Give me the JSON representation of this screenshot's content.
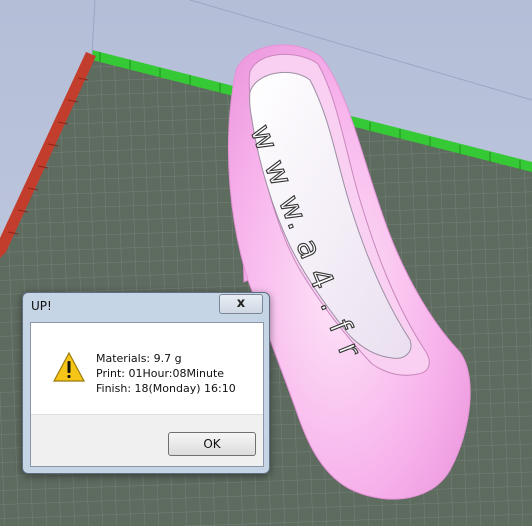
{
  "dialog": {
    "title": "UP!",
    "close_label": "x",
    "icon": "warning-icon",
    "lines": [
      "Materials: 9.7 g",
      "Print: 01Hour:08Minute",
      "Finish: 18(Monday) 16:10"
    ],
    "ok_label": "OK"
  },
  "model": {
    "insole_text": "w w w. a 4 . f r",
    "color": "#f2a6e6"
  },
  "colors": {
    "background": "#b9c3db",
    "grid_floor": "#5e6b5f",
    "grid_ruler_green": "#2fd12f",
    "grid_ruler_red": "#c23d2b",
    "dialog_frame": "#c6d5e6"
  }
}
